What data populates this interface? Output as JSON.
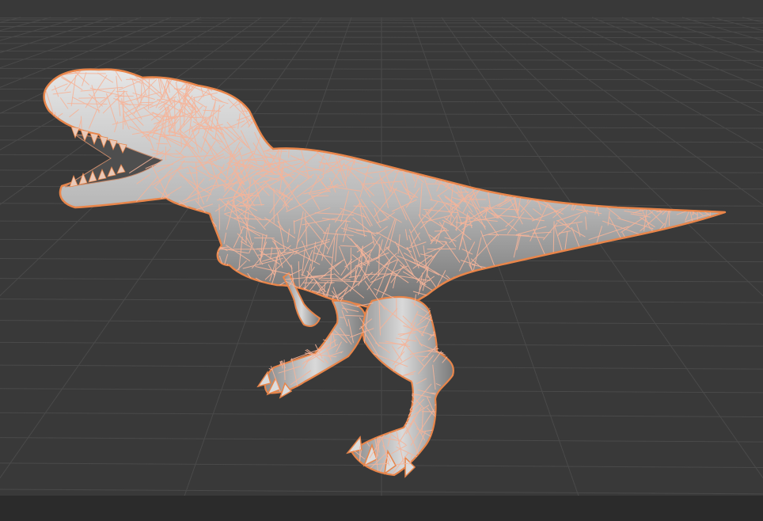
{
  "viewport": {
    "mode": "3d-viewport",
    "background_color": "#393939",
    "grid_line_color": "#4a4a4a",
    "grid_visible": true,
    "status_strip_color": "#2b2b2b"
  },
  "object": {
    "icon": "trex-model-icon",
    "selected": true,
    "shading": "solid",
    "mesh_color": "#bdbdbd",
    "selection_outline_color": "#e8854a",
    "hair_particle_color": "#f5b49a",
    "particle_system_visible": true
  }
}
